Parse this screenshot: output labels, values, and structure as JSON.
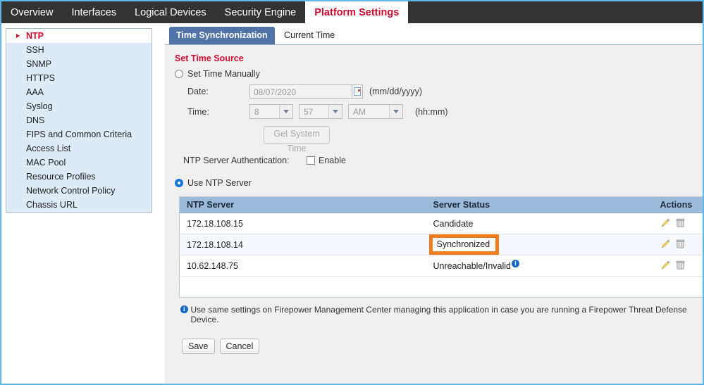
{
  "topnav": {
    "items": [
      {
        "label": "Overview",
        "active": false
      },
      {
        "label": "Interfaces",
        "active": false
      },
      {
        "label": "Logical Devices",
        "active": false
      },
      {
        "label": "Security Engine",
        "active": false
      },
      {
        "label": "Platform Settings",
        "active": true
      }
    ]
  },
  "sidebar": {
    "items": [
      {
        "label": "NTP",
        "selected": true
      },
      {
        "label": "SSH",
        "selected": false
      },
      {
        "label": "SNMP",
        "selected": false
      },
      {
        "label": "HTTPS",
        "selected": false
      },
      {
        "label": "AAA",
        "selected": false
      },
      {
        "label": "Syslog",
        "selected": false
      },
      {
        "label": "DNS",
        "selected": false
      },
      {
        "label": "FIPS and Common Criteria",
        "selected": false
      },
      {
        "label": "Access List",
        "selected": false
      },
      {
        "label": "MAC Pool",
        "selected": false
      },
      {
        "label": "Resource Profiles",
        "selected": false
      },
      {
        "label": "Network Control Policy",
        "selected": false
      },
      {
        "label": "Chassis URL",
        "selected": false
      }
    ]
  },
  "tabs": [
    {
      "label": "Time Synchronization",
      "active": true
    },
    {
      "label": "Current Time",
      "active": false
    }
  ],
  "form": {
    "section_title": "Set Time Source",
    "set_time_manually_label": "Set Time Manually",
    "set_time_manually_selected": false,
    "date_label": "Date:",
    "date_value": "08/07/2020",
    "date_hint": "(mm/dd/yyyy)",
    "time_label": "Time:",
    "hour_value": "8",
    "minute_value": "57",
    "ampm_value": "AM",
    "time_hint": "(hh:mm)",
    "get_system_time_label": "Get System Time",
    "ntp_auth_label": "NTP Server Authentication:",
    "ntp_auth_enable_label": "Enable",
    "ntp_auth_enabled": false,
    "use_ntp_server_label": "Use NTP Server",
    "use_ntp_server_selected": true
  },
  "table": {
    "headers": [
      "NTP Server",
      "Server Status",
      "Actions"
    ],
    "rows": [
      {
        "server": "172.18.108.15",
        "status": "Candidate",
        "highlighted": false,
        "has_info": false
      },
      {
        "server": "172.18.108.14",
        "status": "Synchronized",
        "highlighted": true,
        "has_info": false
      },
      {
        "server": "10.62.148.75",
        "status": "Unreachable/Invalid",
        "highlighted": false,
        "has_info": true
      }
    ],
    "action_icons": [
      "edit-pencil-icon",
      "delete-trash-icon"
    ]
  },
  "footer": {
    "note": "Use same settings on Firepower Management Center managing this application in case you are running a Firepower Threat Defense Device.",
    "save_label": "Save",
    "cancel_label": "Cancel"
  },
  "colors": {
    "topnav_bg": "#333333",
    "brand_red": "#cf0a2c",
    "tab_active_bg": "#5273a8",
    "table_header_bg": "#9cbada",
    "highlight_orange": "#f07d20",
    "info_blue": "#1569c8",
    "window_border": "#5bb8e8"
  }
}
